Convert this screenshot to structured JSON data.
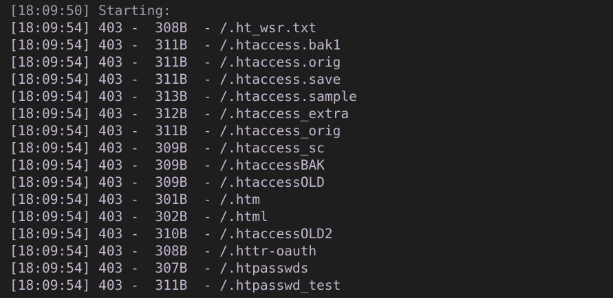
{
  "terminal": {
    "status_line": "[18:09:50] Starting: ",
    "lines": [
      {
        "time": "[18:09:54]",
        "code": "403",
        "size": "308B",
        "path": "/.ht_wsr.txt"
      },
      {
        "time": "[18:09:54]",
        "code": "403",
        "size": "311B",
        "path": "/.htaccess.bak1"
      },
      {
        "time": "[18:09:54]",
        "code": "403",
        "size": "311B",
        "path": "/.htaccess.orig"
      },
      {
        "time": "[18:09:54]",
        "code": "403",
        "size": "311B",
        "path": "/.htaccess.save"
      },
      {
        "time": "[18:09:54]",
        "code": "403",
        "size": "313B",
        "path": "/.htaccess.sample"
      },
      {
        "time": "[18:09:54]",
        "code": "403",
        "size": "312B",
        "path": "/.htaccess_extra"
      },
      {
        "time": "[18:09:54]",
        "code": "403",
        "size": "311B",
        "path": "/.htaccess_orig"
      },
      {
        "time": "[18:09:54]",
        "code": "403",
        "size": "309B",
        "path": "/.htaccess_sc"
      },
      {
        "time": "[18:09:54]",
        "code": "403",
        "size": "309B",
        "path": "/.htaccessBAK"
      },
      {
        "time": "[18:09:54]",
        "code": "403",
        "size": "309B",
        "path": "/.htaccessOLD"
      },
      {
        "time": "[18:09:54]",
        "code": "403",
        "size": "301B",
        "path": "/.htm"
      },
      {
        "time": "[18:09:54]",
        "code": "403",
        "size": "302B",
        "path": "/.html"
      },
      {
        "time": "[18:09:54]",
        "code": "403",
        "size": "310B",
        "path": "/.htaccessOLD2"
      },
      {
        "time": "[18:09:54]",
        "code": "403",
        "size": "308B",
        "path": "/.httr-oauth"
      },
      {
        "time": "[18:09:54]",
        "code": "403",
        "size": "307B",
        "path": "/.htpasswds"
      },
      {
        "time": "[18:09:54]",
        "code": "403",
        "size": "311B",
        "path": "/.htpasswd_test"
      }
    ],
    "separator": "-",
    "colors": {
      "background": "#1e1e1e",
      "text": "#c3b6cf",
      "status_text": "#a19aa8",
      "partial_line": "#c7a14b"
    }
  }
}
